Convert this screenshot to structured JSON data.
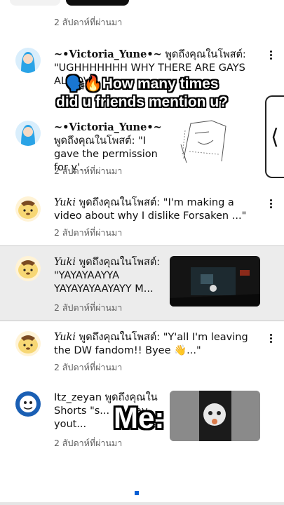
{
  "top_item": {
    "timestamp": "2 สัปดาห์ที่ผ่านมา"
  },
  "notifications": [
    {
      "name": "~•Victoria_Yune•~",
      "text": " พูดถึงคุณในโพสต์: \"UGHHHHHHH WHY THERE ARE GAYS ALL OV...",
      "timestamp": "2 สัปดาห์ที่ผ่านมา"
    },
    {
      "name": "~•Victoria_Yune•~",
      "text": " พูดถึงคุณในโพสต์: \"I gave the permission for y'...",
      "timestamp": "2 สัปดาห์ที่ผ่านมา"
    },
    {
      "name": "Yuki",
      "text": " พูดถึงคุณในโพสต์: \"I'm making a video about why I dislike Forsaken ...\"",
      "timestamp": "2 สัปดาห์ที่ผ่านมา"
    },
    {
      "name": "Yuki",
      "text": " พูดถึงคุณในโพสต์: \"YAYAYAAYYA YAYAYAYAAYAYY M...",
      "timestamp": "2 สัปดาห์ที่ผ่านมา"
    },
    {
      "name": "Yuki",
      "text": " พูดถึงคุณในโพสต์: \"Y'all I'm leaving the DW fandom!! Byee 👋...\"",
      "timestamp": "2 สัปดาห์ที่ผ่านมา"
    },
    {
      "name": "Itz_zeyan",
      "text": " พูดถึงคุณใน Shorts \"s... my fav yout...",
      "timestamp": "2 สัปดาห์ที่ผ่านมา"
    }
  ],
  "overlay": {
    "caption_emoji": "🗣️🔥",
    "caption_line1": "How many times",
    "caption_line2": "did u friends mention u?",
    "me_label": "Me:"
  },
  "side_tab_glyph": "⟨",
  "icons": [
    "kebab-menu-icon",
    "sound-icon",
    "fire-icon",
    "chevron-left-icon"
  ],
  "colors": {
    "highlight_row": "#ececec",
    "timestamp": "#606060",
    "accent": "#065fd4"
  }
}
